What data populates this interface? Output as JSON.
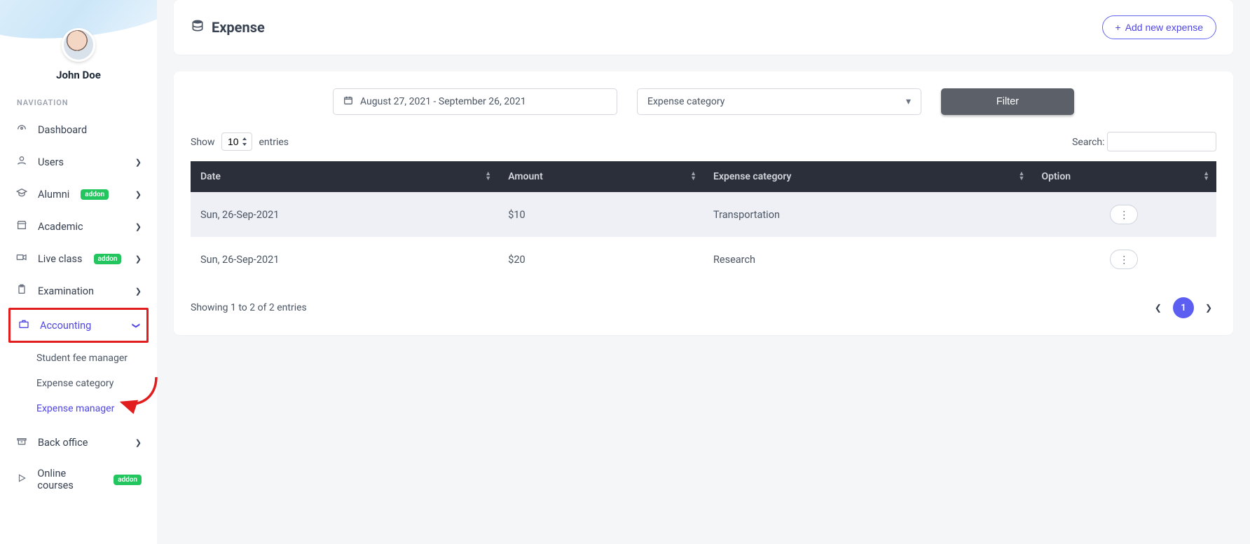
{
  "user": {
    "name": "John Doe"
  },
  "sidebar": {
    "heading": "NAVIGATION",
    "items": [
      {
        "label": "Dashboard"
      },
      {
        "label": "Users"
      },
      {
        "label": "Alumni",
        "addon": "addon"
      },
      {
        "label": "Academic"
      },
      {
        "label": "Live class",
        "addon": "addon"
      },
      {
        "label": "Examination"
      },
      {
        "label": "Accounting"
      },
      {
        "label": "Back office"
      },
      {
        "label": "Online courses",
        "addon": "addon"
      }
    ],
    "accounting_children": [
      {
        "label": "Student fee manager"
      },
      {
        "label": "Expense category"
      },
      {
        "label": "Expense manager"
      }
    ]
  },
  "header": {
    "title": "Expense",
    "add_btn": "Add new expense"
  },
  "filters": {
    "date_range": "August 27, 2021 - September 26, 2021",
    "category_placeholder": "Expense category",
    "filter_btn": "Filter"
  },
  "table": {
    "length_prefix": "Show",
    "length_value": "10",
    "length_suffix": "entries",
    "search_label": "Search:",
    "columns": {
      "date": "Date",
      "amount": "Amount",
      "category": "Expense category",
      "option": "Option"
    },
    "rows": [
      {
        "date": "Sun, 26-Sep-2021",
        "amount": "$10",
        "category": "Transportation"
      },
      {
        "date": "Sun, 26-Sep-2021",
        "amount": "$20",
        "category": "Research"
      }
    ],
    "info": "Showing 1 to 2 of 2 entries",
    "page_current": "1"
  }
}
